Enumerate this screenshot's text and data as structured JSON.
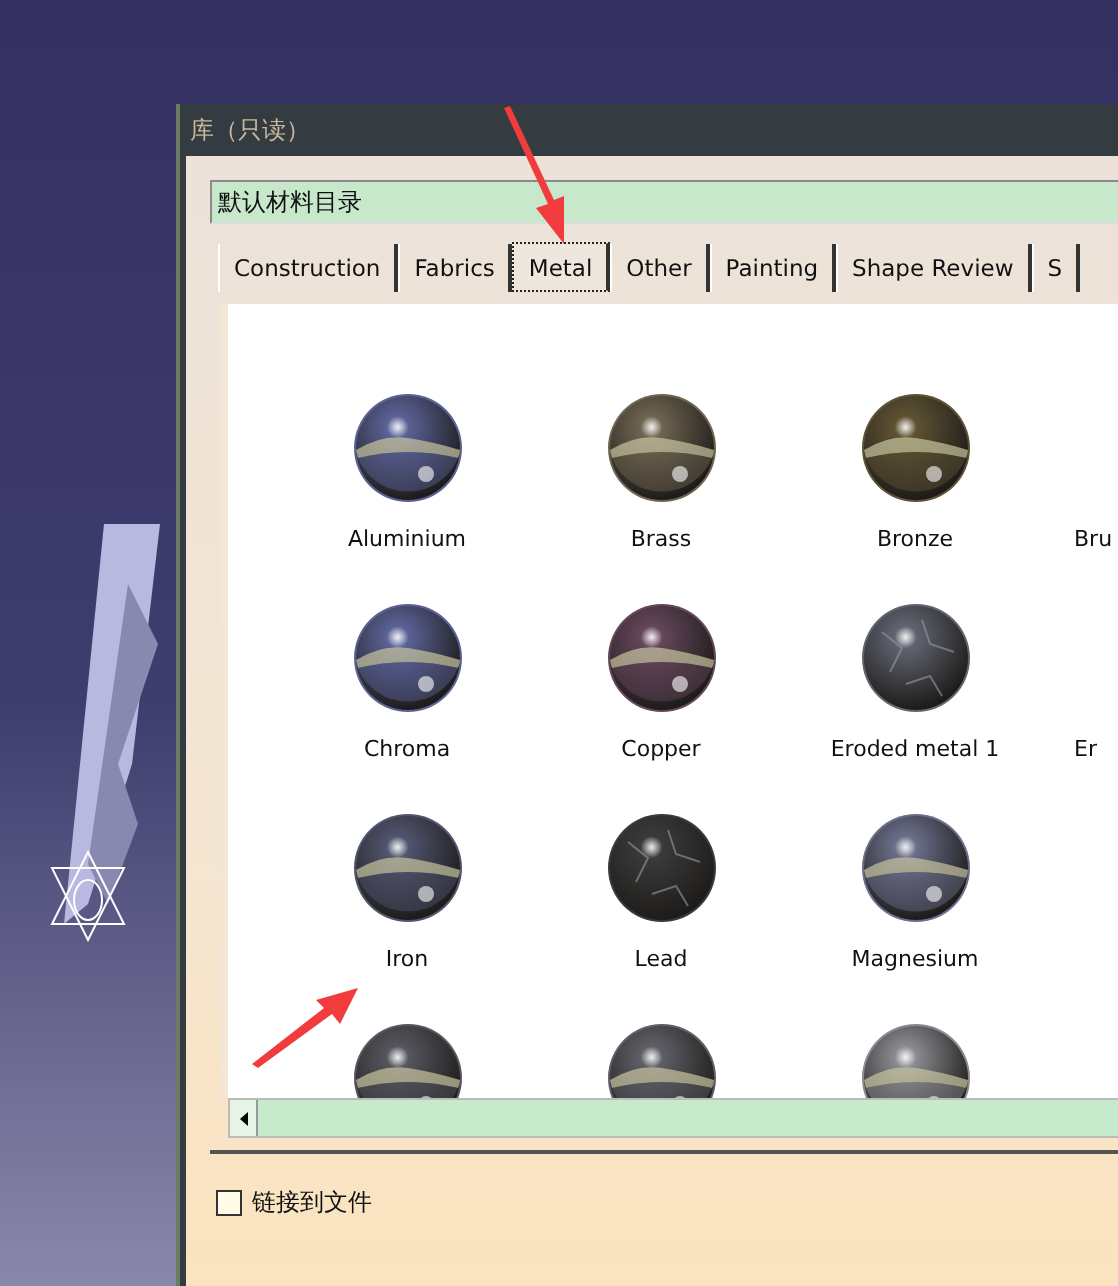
{
  "window": {
    "title": "库（只读）"
  },
  "catalog_field": {
    "value": "默认材料目录"
  },
  "tabs": [
    {
      "label": "Construction",
      "selected": false
    },
    {
      "label": "Fabrics",
      "selected": false
    },
    {
      "label": "Metal",
      "selected": true
    },
    {
      "label": "Other",
      "selected": false
    },
    {
      "label": "Painting",
      "selected": false
    },
    {
      "label": "Shape Review",
      "selected": false
    },
    {
      "label": "S",
      "selected": false
    }
  ],
  "material_rows": [
    [
      {
        "name": "Aluminium",
        "kind": "glossy",
        "color": "#5a6296"
      },
      {
        "name": "Brass",
        "kind": "glossy",
        "color": "#6e6450"
      },
      {
        "name": "Bronze",
        "kind": "glossy",
        "color": "#5e5232"
      },
      {
        "name": "Bru"
      }
    ],
    [
      {
        "name": "Chroma",
        "kind": "glossy",
        "color": "#5a6296"
      },
      {
        "name": "Copper",
        "kind": "glossy",
        "color": "#64465a"
      },
      {
        "name": "Eroded metal 1",
        "kind": "rough",
        "color": "#606470"
      },
      {
        "name": "Er"
      }
    ],
    [
      {
        "name": "Iron",
        "kind": "glossy",
        "color": "#50546e"
      },
      {
        "name": "Lead",
        "kind": "rough",
        "color": "#3a3a3a"
      },
      {
        "name": "Magnesium",
        "kind": "glossy",
        "color": "#6a6e8a"
      }
    ],
    [
      {
        "kind": "glossy",
        "color": "#55565e"
      },
      {
        "kind": "glossy",
        "color": "#5e5f66"
      },
      {
        "kind": "glossy",
        "color": "#8a8a90"
      }
    ]
  ],
  "link_to_file": {
    "label": "链接到文件",
    "checked": false
  }
}
